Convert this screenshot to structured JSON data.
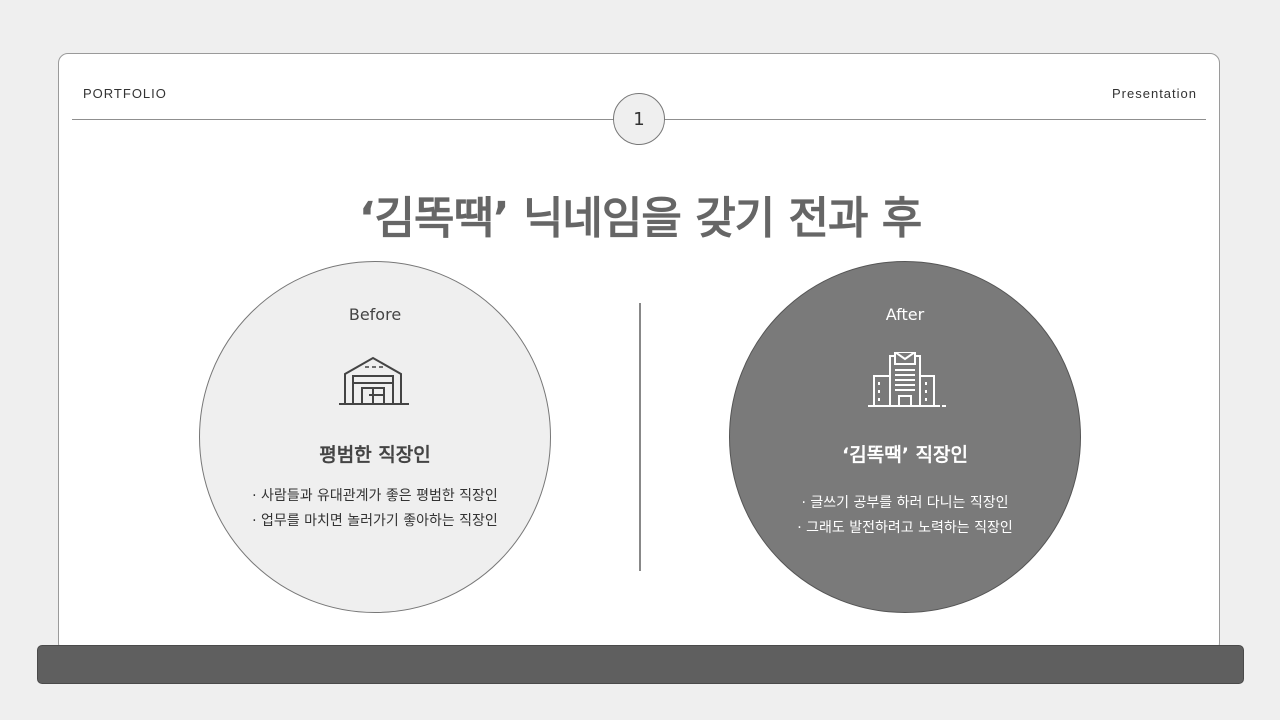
{
  "header": {
    "left_label": "PORTFOLIO",
    "right_label": "Presentation",
    "page_number": "1"
  },
  "title": "‘김똑땍’ 닉네임을 갖기 전과 후",
  "before": {
    "label": "Before",
    "icon": "warehouse-icon",
    "heading": "평범한 직장인",
    "items": [
      "· 사람들과 유대관계가 좋은 평범한 직장인",
      "· 업무를 마치면 놀러가기 좋아하는 직장인"
    ]
  },
  "after": {
    "label": "After",
    "icon": "office-building-icon",
    "heading": "‘김똑땍’ 직장인",
    "items": [
      "· 글쓰기 공부를 하러 다니는 직장인",
      "· 그래도 발전하려고 노력하는 직장인"
    ]
  },
  "colors": {
    "page_background": "#efefef",
    "slide_background": "#ffffff",
    "before_circle": "#efefef",
    "after_circle": "#7a7a7a",
    "bottom_bar": "#5f5f5f",
    "title_text": "#666666"
  }
}
